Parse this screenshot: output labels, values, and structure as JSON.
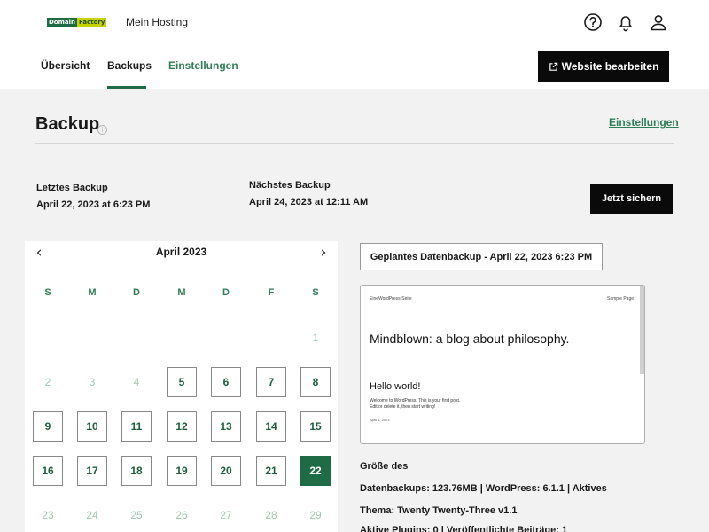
{
  "header": {
    "logo_part1": "Domain",
    "logo_part2": "Factory",
    "site_name": "Mein Hosting",
    "icons": [
      "help-icon",
      "bell-icon",
      "user-icon"
    ]
  },
  "tabs": [
    {
      "label": "Übersicht",
      "active": false
    },
    {
      "label": "Backups",
      "active": true
    },
    {
      "label": "Einstellungen",
      "active": false
    }
  ],
  "edit_website_label": "Website bearbeiten",
  "page": {
    "title": "Backup",
    "info_glyph": "i",
    "settings_link": "Einstellungen"
  },
  "last_backup": {
    "label": "Letztes Backup",
    "value": "April 22, 2023 at 6:23 PM"
  },
  "next_backup": {
    "label": "Nächstes Backup",
    "value": "April 24, 2023 at 12:11 AM"
  },
  "save_now_label": "Jetzt sichern",
  "calendar": {
    "month": "April 2023",
    "prev": "‹",
    "next": "›",
    "weekdays": [
      "S",
      "M",
      "D",
      "M",
      "D",
      "F",
      "S"
    ],
    "weeks": [
      [
        {
          "d": "",
          "s": "none"
        },
        {
          "d": "",
          "s": "none"
        },
        {
          "d": "",
          "s": "none"
        },
        {
          "d": "",
          "s": "none"
        },
        {
          "d": "",
          "s": "none"
        },
        {
          "d": "",
          "s": "none"
        },
        {
          "d": "1",
          "s": "muted"
        }
      ],
      [
        {
          "d": "2",
          "s": "muted"
        },
        {
          "d": "3",
          "s": "muted"
        },
        {
          "d": "4",
          "s": "muted"
        },
        {
          "d": "5",
          "s": "box"
        },
        {
          "d": "6",
          "s": "box"
        },
        {
          "d": "7",
          "s": "box"
        },
        {
          "d": "8",
          "s": "box"
        }
      ],
      [
        {
          "d": "9",
          "s": "box"
        },
        {
          "d": "10",
          "s": "box"
        },
        {
          "d": "11",
          "s": "box"
        },
        {
          "d": "12",
          "s": "box"
        },
        {
          "d": "13",
          "s": "box"
        },
        {
          "d": "14",
          "s": "box"
        },
        {
          "d": "15",
          "s": "box"
        }
      ],
      [
        {
          "d": "16",
          "s": "box"
        },
        {
          "d": "17",
          "s": "box"
        },
        {
          "d": "18",
          "s": "box"
        },
        {
          "d": "19",
          "s": "box"
        },
        {
          "d": "20",
          "s": "box"
        },
        {
          "d": "21",
          "s": "box"
        },
        {
          "d": "22",
          "s": "selected"
        }
      ],
      [
        {
          "d": "23",
          "s": "muted"
        },
        {
          "d": "24",
          "s": "muted"
        },
        {
          "d": "25",
          "s": "muted"
        },
        {
          "d": "26",
          "s": "muted"
        },
        {
          "d": "27",
          "s": "muted"
        },
        {
          "d": "28",
          "s": "muted"
        },
        {
          "d": "29",
          "s": "muted"
        }
      ]
    ]
  },
  "scheduled_backup_label": "Geplantes Datenbackup - April 22, 2023 6:23 PM",
  "preview": {
    "site_title": "EineWordPress-Seite",
    "nav_link": "Sample Page",
    "headline": "Mindblown: a blog about philosophy.",
    "post_title": "Hello world!",
    "post_excerpt": "Welcome to WordPress. This is your first post. Edit or delete it, then start writing!",
    "post_date": "April 5, 2023"
  },
  "stats": {
    "line1": "Größe des",
    "line2": "Datenbackups: 123.76MB  |  WordPress: 6.1.1  |  Aktives",
    "line3": "Thema: Twenty Twenty-Three v1.1",
    "line4": "Aktive Plugins: 0  |  Veröffentlichte Beiträge: 1"
  }
}
